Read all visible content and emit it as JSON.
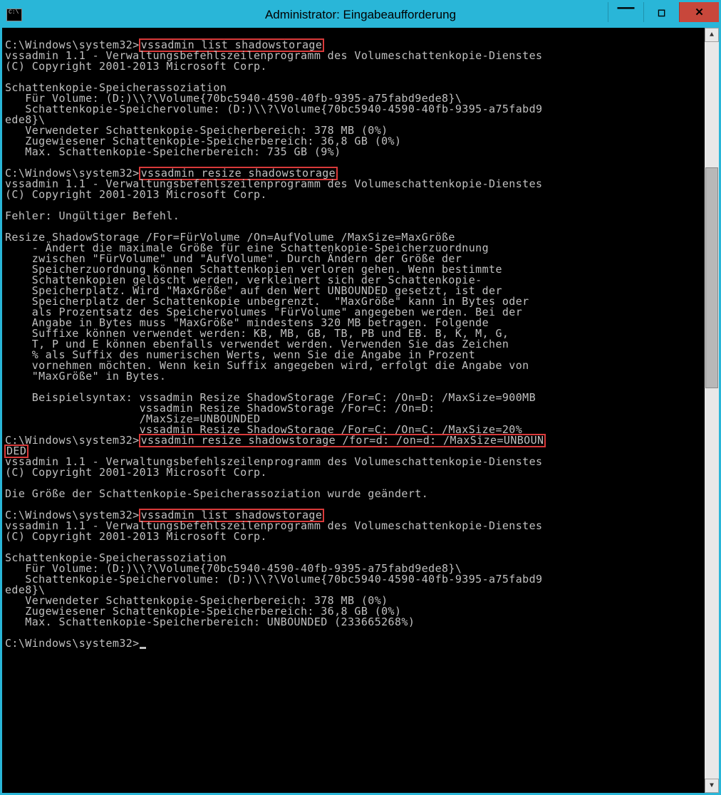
{
  "window": {
    "title": "Administrator: Eingabeaufforderung"
  },
  "prompt": "C:\\Windows\\system32>",
  "cmd1": "vssadmin list shadowstorage",
  "cmd2": "vssadmin resize shadowstorage",
  "cmd3a": "vssadmin resize shadowstorage /for=d: /on=d: /MaxSize=UNBOUN",
  "cmd3b": "DED",
  "cmd4": "vssadmin list shadowstorage",
  "block_top": "",
  "block1": "vssadmin 1.1 - Verwaltungsbefehlszeilenprogramm des Volumeschattenkopie-Dienstes\n(C) Copyright 2001-2013 Microsoft Corp.\n\nSchattenkopie-Speicherassoziation\n   Für Volume: (D:)\\\\?\\Volume{70bc5940-4590-40fb-9395-a75fabd9ede8}\\\n   Schattenkopie-Speichervolume: (D:)\\\\?\\Volume{70bc5940-4590-40fb-9395-a75fabd9\nede8}\\\n   Verwendeter Schattenkopie-Speicherbereich: 378 MB (0%)\n   Zugewiesener Schattenkopie-Speicherbereich: 36,8 GB (0%)\n   Max. Schattenkopie-Speicherbereich: 735 GB (9%)\n",
  "block2": "vssadmin 1.1 - Verwaltungsbefehlszeilenprogramm des Volumeschattenkopie-Dienstes\n(C) Copyright 2001-2013 Microsoft Corp.\n\nFehler: Ungültiger Befehl.\n\nResize ShadowStorage /For=FürVolume /On=AufVolume /MaxSize=MaxGröße\n    - Ändert die maximale Größe für eine Schattenkopie-Speicherzuordnung\n    zwischen \"FürVolume\" und \"AufVolume\". Durch Ändern der Größe der\n    Speicherzuordnung können Schattenkopien verloren gehen. Wenn bestimmte\n    Schattenkopien gelöscht werden, verkleinert sich der Schattenkopie-\n    Speicherplatz. Wird \"MaxGröße\" auf den Wert UNBOUNDED gesetzt, ist der\n    Speicherplatz der Schattenkopie unbegrenzt.  \"MaxGröße\" kann in Bytes oder\n    als Prozentsatz des Speichervolumes \"FürVolume\" angegeben werden. Bei der\n    Angabe in Bytes muss \"MaxGröße\" mindestens 320 MB betragen. Folgende\n    Suffixe können verwendet werden: KB, MB, GB, TB, PB und EB. B, K, M, G,\n    T, P und E können ebenfalls verwendet werden. Verwenden Sie das Zeichen\n    % als Suffix des numerischen Werts, wenn Sie die Angabe in Prozent\n    vornehmen möchten. Wenn kein Suffix angegeben wird, erfolgt die Angabe von\n    \"MaxGröße\" in Bytes.\n\n    Beispielsyntax: vssadmin Resize ShadowStorage /For=C: /On=D: /MaxSize=900MB\n                    vssadmin Resize ShadowStorage /For=C: /On=D:\n                    /MaxSize=UNBOUNDED\n                    vssadmin Resize ShadowStorage /For=C: /On=C: /MaxSize=20%\n",
  "block3": "vssadmin 1.1 - Verwaltungsbefehlszeilenprogramm des Volumeschattenkopie-Dienstes\n(C) Copyright 2001-2013 Microsoft Corp.\n\nDie Größe der Schattenkopie-Speicherassoziation wurde geändert.\n",
  "block4": "vssadmin 1.1 - Verwaltungsbefehlszeilenprogramm des Volumeschattenkopie-Dienstes\n(C) Copyright 2001-2013 Microsoft Corp.\n\nSchattenkopie-Speicherassoziation\n   Für Volume: (D:)\\\\?\\Volume{70bc5940-4590-40fb-9395-a75fabd9ede8}\\\n   Schattenkopie-Speichervolume: (D:)\\\\?\\Volume{70bc5940-4590-40fb-9395-a75fabd9\nede8}\\\n   Verwendeter Schattenkopie-Speicherbereich: 378 MB (0%)\n   Zugewiesener Schattenkopie-Speicherbereich: 36,8 GB (0%)\n   Max. Schattenkopie-Speicherbereich: UNBOUNDED (233665268%)\n"
}
